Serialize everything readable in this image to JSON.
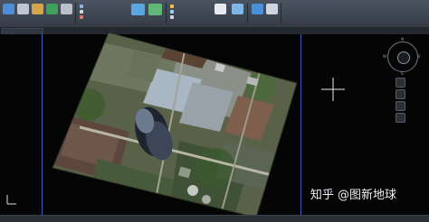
{
  "ribbon": {
    "groups": [
      {
        "title": ""
      },
      {
        "title": ""
      },
      {
        "title": ""
      }
    ],
    "row_labels": [
      "",
      ""
    ],
    "buttons": [
      {
        "label": ""
      },
      {
        "label": ""
      },
      {
        "label": ""
      },
      {
        "label": ""
      },
      {
        "label": ""
      },
      {
        "label": ""
      },
      {
        "label": ""
      },
      {
        "label": ""
      }
    ]
  },
  "tabs": [
    {
      "label": "…"
    },
    {
      "label": ""
    }
  ],
  "viewport": {
    "nav_directions": {
      "north": "N",
      "west": "W",
      "east": "E",
      "south": "S"
    },
    "compass_center": "",
    "watermark_text": "知乎 @图新地球"
  },
  "statusbar": {
    "items": [
      "",
      "",
      "",
      ""
    ]
  },
  "colors": {
    "ribbon_bg": "#3b424d",
    "viewport_bg": "#050506",
    "viewport_border": "#3b5dbb",
    "accent_blue": "#2e86de"
  }
}
